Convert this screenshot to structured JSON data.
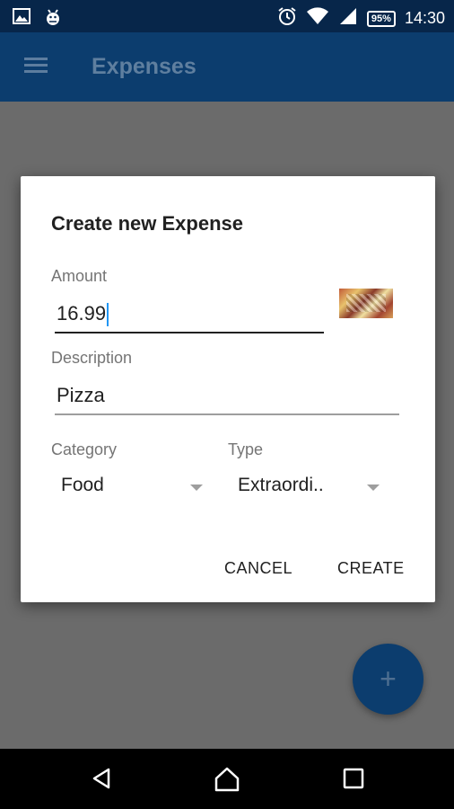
{
  "status_bar": {
    "time": "14:30",
    "battery": "95%",
    "icons": [
      "image-icon",
      "android-debug-icon",
      "alarm-icon",
      "wifi-icon",
      "signal-icon",
      "battery-icon"
    ]
  },
  "app_bar": {
    "title": "Expenses",
    "menu_icon": "hamburger-menu-icon"
  },
  "dialog": {
    "title": "Create new Expense",
    "amount": {
      "label": "Amount",
      "value": "16.99"
    },
    "description": {
      "label": "Description",
      "value": "Pizza"
    },
    "category": {
      "label": "Category",
      "selected": "Food"
    },
    "type": {
      "label": "Type",
      "selected": "Extraordi.."
    },
    "cancel_label": "CANCEL",
    "create_label": "CREATE"
  },
  "fab": {
    "label": "+",
    "icon": "plus-icon"
  },
  "nav_bar": {
    "icons": [
      "back-icon",
      "home-icon",
      "recents-icon"
    ]
  },
  "colors": {
    "status_bar": "#07264a",
    "app_bar": "#0c3d6e",
    "accent_cursor": "#2196f3"
  }
}
